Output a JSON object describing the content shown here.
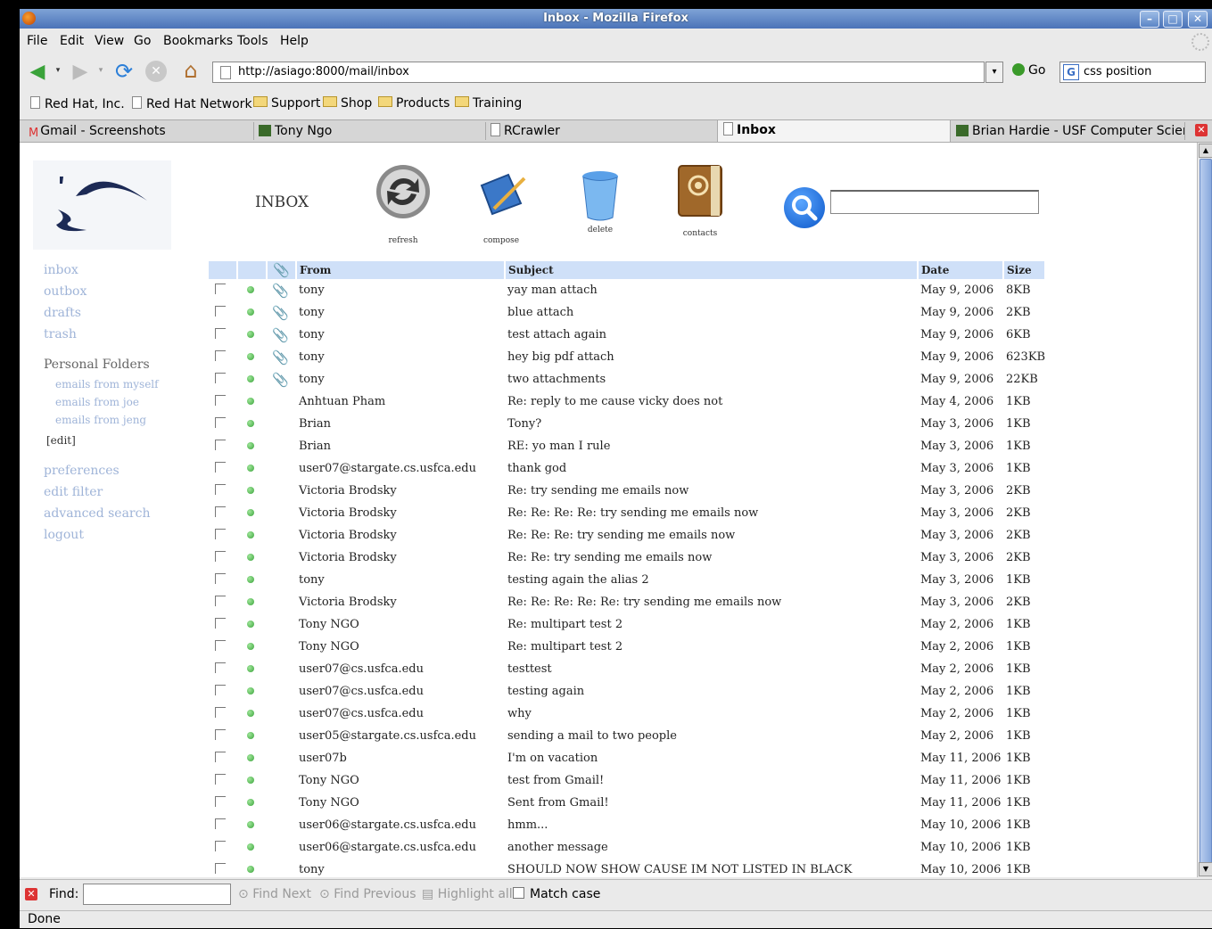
{
  "window": {
    "title": "Inbox - Mozilla Firefox"
  },
  "menu": [
    "File",
    "Edit",
    "View",
    "Go",
    "Bookmarks",
    "Tools",
    "Help"
  ],
  "nav": {
    "url": "http://asiago:8000/mail/inbox",
    "go_label": "Go",
    "search_value": "css position"
  },
  "bookmarks": [
    "Red Hat, Inc.",
    "Red Hat Network",
    "Support",
    "Shop",
    "Products",
    "Training"
  ],
  "tabs": [
    "Gmail - Screenshots",
    "Tony Ngo",
    "RCrawler",
    "Inbox",
    "Brian Hardie - USF Computer Scien..."
  ],
  "sidebar": {
    "links": [
      "inbox",
      "outbox",
      "drafts",
      "trash"
    ],
    "personal_heading": "Personal Folders",
    "folders": [
      "emails from myself",
      "emails from joe",
      "emails from jeng"
    ],
    "edit_label": "[edit]",
    "bottom_links": [
      "preferences",
      "edit filter",
      "advanced search",
      "logout"
    ]
  },
  "toolbar": {
    "inbox_title": "INBOX",
    "refresh": "refresh",
    "compose": "compose",
    "delete": "delete",
    "contacts": "contacts"
  },
  "table": {
    "headers": {
      "from": "From",
      "subject": "Subject",
      "date": "Date",
      "size": "Size"
    },
    "rows": [
      {
        "from": "tony",
        "subject": "yay man attach",
        "date": "May 9, 2006",
        "size": "8KB",
        "attach": true
      },
      {
        "from": "tony",
        "subject": "blue attach",
        "date": "May 9, 2006",
        "size": "2KB",
        "attach": true
      },
      {
        "from": "tony",
        "subject": "test attach again",
        "date": "May 9, 2006",
        "size": "6KB",
        "attach": true
      },
      {
        "from": "tony",
        "subject": "hey big pdf attach",
        "date": "May 9, 2006",
        "size": "623KB",
        "attach": true
      },
      {
        "from": "tony",
        "subject": "two attachments",
        "date": "May 9, 2006",
        "size": "22KB",
        "attach": true
      },
      {
        "from": "Anhtuan Pham",
        "subject": "Re: reply to me cause vicky does not",
        "date": "May 4, 2006",
        "size": "1KB",
        "attach": false
      },
      {
        "from": "Brian",
        "subject": "Tony?",
        "date": "May 3, 2006",
        "size": "1KB",
        "attach": false
      },
      {
        "from": "Brian",
        "subject": "RE: yo man I rule",
        "date": "May 3, 2006",
        "size": "1KB",
        "attach": false
      },
      {
        "from": "user07@stargate.cs.usfca.edu",
        "subject": "thank god",
        "date": "May 3, 2006",
        "size": "1KB",
        "attach": false
      },
      {
        "from": "Victoria Brodsky",
        "subject": "Re: try sending me emails now",
        "date": "May 3, 2006",
        "size": "2KB",
        "attach": false
      },
      {
        "from": "Victoria Brodsky",
        "subject": "Re: Re: Re: Re: try sending me emails now",
        "date": "May 3, 2006",
        "size": "2KB",
        "attach": false
      },
      {
        "from": "Victoria Brodsky",
        "subject": "Re: Re: Re: try sending me emails now",
        "date": "May 3, 2006",
        "size": "2KB",
        "attach": false
      },
      {
        "from": "Victoria Brodsky",
        "subject": "Re: Re: try sending me emails now",
        "date": "May 3, 2006",
        "size": "2KB",
        "attach": false
      },
      {
        "from": "tony",
        "subject": "testing again the alias 2",
        "date": "May 3, 2006",
        "size": "1KB",
        "attach": false
      },
      {
        "from": "Victoria Brodsky",
        "subject": "Re: Re: Re: Re: Re: try sending me emails now",
        "date": "May 3, 2006",
        "size": "2KB",
        "attach": false
      },
      {
        "from": "Tony NGO",
        "subject": "Re: multipart test 2",
        "date": "May 2, 2006",
        "size": "1KB",
        "attach": false
      },
      {
        "from": "Tony NGO",
        "subject": "Re: multipart test 2",
        "date": "May 2, 2006",
        "size": "1KB",
        "attach": false
      },
      {
        "from": "user07@cs.usfca.edu",
        "subject": "testtest",
        "date": "May 2, 2006",
        "size": "1KB",
        "attach": false
      },
      {
        "from": "user07@cs.usfca.edu",
        "subject": "testing again",
        "date": "May 2, 2006",
        "size": "1KB",
        "attach": false
      },
      {
        "from": "user07@cs.usfca.edu",
        "subject": "why",
        "date": "May 2, 2006",
        "size": "1KB",
        "attach": false
      },
      {
        "from": "user05@stargate.cs.usfca.edu",
        "subject": "sending a mail to two people",
        "date": "May 2, 2006",
        "size": "1KB",
        "attach": false
      },
      {
        "from": "user07b",
        "subject": "I'm on vacation",
        "date": "May 11, 2006",
        "size": "1KB",
        "attach": false
      },
      {
        "from": "Tony NGO",
        "subject": "test from Gmail!",
        "date": "May 11, 2006",
        "size": "1KB",
        "attach": false
      },
      {
        "from": "Tony NGO",
        "subject": "Sent from Gmail!",
        "date": "May 11, 2006",
        "size": "1KB",
        "attach": false
      },
      {
        "from": "user06@stargate.cs.usfca.edu",
        "subject": "hmm...",
        "date": "May 10, 2006",
        "size": "1KB",
        "attach": false
      },
      {
        "from": "user06@stargate.cs.usfca.edu",
        "subject": "another message",
        "date": "May 10, 2006",
        "size": "1KB",
        "attach": false
      },
      {
        "from": "tony",
        "subject": "SHOULD NOW SHOW CAUSE IM NOT LISTED IN BLACK",
        "date": "May 10, 2006",
        "size": "1KB",
        "attach": false
      }
    ]
  },
  "findbar": {
    "label": "Find:",
    "find_next": "Find Next",
    "find_previous": "Find Previous",
    "highlight_all": "Highlight all",
    "match_case": "Match case"
  },
  "status": "Done"
}
